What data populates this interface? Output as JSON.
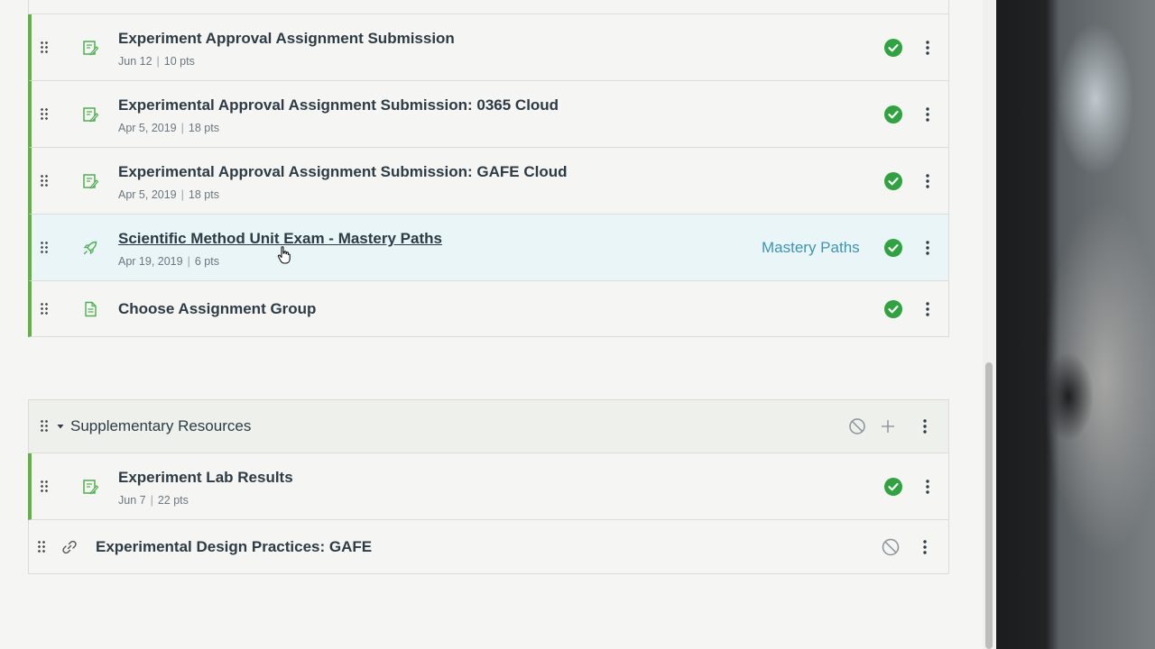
{
  "modules": [
    {
      "items": [
        {
          "title": "Experiment Approval Assignment Submission",
          "date": "Jun 12",
          "points": "10 pts",
          "icon": "assignment-icon",
          "published": true
        },
        {
          "title": "Experimental Approval Assignment Submission: 0365 Cloud",
          "date": "Apr 5, 2019",
          "points": "18 pts",
          "icon": "assignment-icon",
          "published": true
        },
        {
          "title": "Experimental Approval Assignment Submission: GAFE Cloud",
          "date": "Apr 5, 2019",
          "points": "18 pts",
          "icon": "assignment-icon",
          "published": true
        },
        {
          "title": "Scientific Method Unit Exam - Mastery Paths",
          "date": "Apr 19, 2019",
          "points": "6 pts",
          "icon": "quiz-rocket-icon",
          "published": true,
          "requirement_label": "Mastery Paths"
        },
        {
          "title": "Choose Assignment Group",
          "icon": "page-icon",
          "published": true
        }
      ]
    },
    {
      "title": "Supplementary Resources",
      "items": [
        {
          "title": "Experiment Lab Results",
          "date": "Jun 7",
          "points": "22 pts",
          "icon": "assignment-icon",
          "published": true
        },
        {
          "title": "Experimental Design Practices: GAFE",
          "icon": "link-icon",
          "published": false
        }
      ]
    }
  ],
  "separator": "|",
  "colors": {
    "published_green": "#2ea33f",
    "published_border": "#5fb43f",
    "mastery_paths_blue": "#3c95b5",
    "hover_row": "#e9f5f6"
  }
}
